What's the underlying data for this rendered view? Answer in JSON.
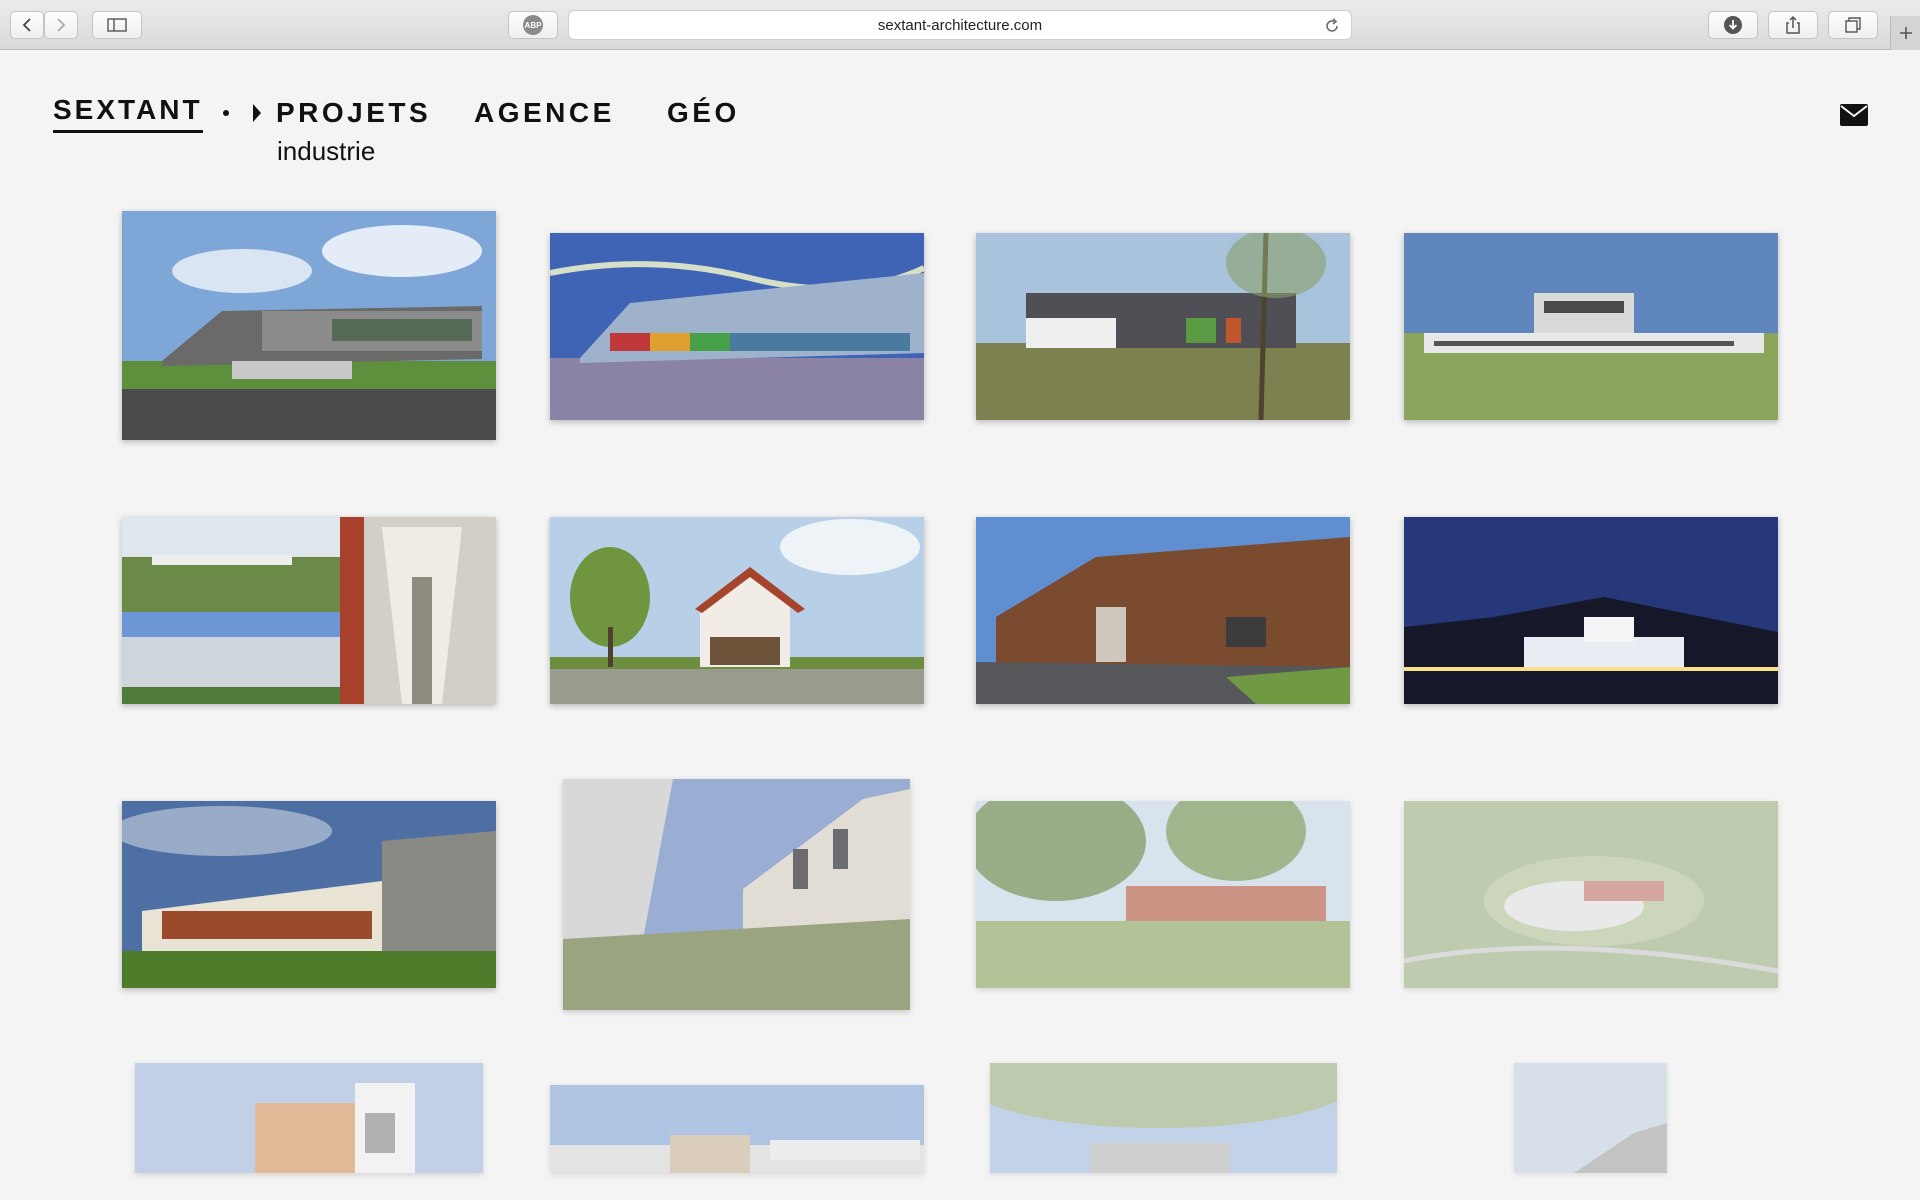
{
  "browser": {
    "url": "sextant-architecture.com",
    "abp_label": "ABP"
  },
  "site": {
    "logo": "SEXTANT",
    "nav": [
      "PROJETS",
      "AGENCE",
      "GÉO"
    ],
    "sub_category": "industrie"
  },
  "gallery": {
    "rows": 4,
    "columns": 4,
    "items": [
      "grey-horizontal-building-blue-sky",
      "glass-building-colorful-facade-rendering",
      "grey-building-colored-panels-shrubs",
      "white-grey-building-grass-field",
      "collage-landscape-louvers-corridor",
      "red-wood-house-rendering",
      "brown-wood-clad-building-parking",
      "white-building-night-sky",
      "white-building-brown-louvers",
      "curved-white-building-courtyard",
      "building-behind-trees-lawn",
      "aerial-campus-rendering",
      "tall-orange-white-building",
      "long-glass-building-rendering",
      "building-behind-tree-canopy",
      "small-white-building-sky"
    ]
  }
}
